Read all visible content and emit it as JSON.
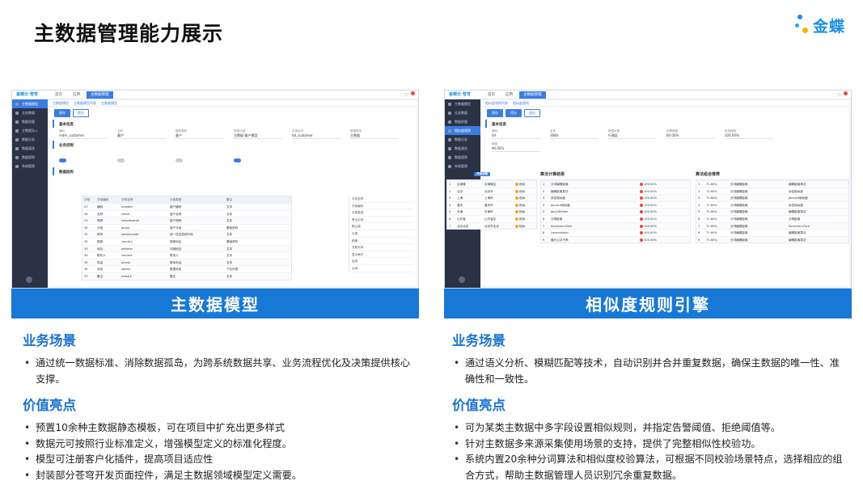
{
  "page": {
    "title": "主数据管理能力展示",
    "logo_text": "金蝶"
  },
  "left": {
    "caption": "主数据模型",
    "app": {
      "brand": "金蝶云·苍穹",
      "tabs": [
        "首页",
        "应用",
        "主数据管理"
      ],
      "sidebar": [
        "主数据模型",
        "业务数据",
        "数据质量",
        "主数据导入",
        "数据分发",
        "数据清洗",
        "数据规则",
        "系统管理"
      ],
      "breadcrumb": [
        "主数据模型",
        "主数据模型列表",
        "主数据模型"
      ],
      "buttons": [
        "保存",
        "提交"
      ],
      "section_basic": "基本信息",
      "fields": [
        {
          "label": "编码",
          "value": "mdm_customer"
        },
        {
          "label": "名称",
          "value": "客户"
        },
        {
          "label": "模型类型",
          "value": "客户"
        },
        {
          "label": "所属分组",
          "value": "主数据-客户模型"
        },
        {
          "label": "实体标识",
          "value": "bd_customer"
        },
        {
          "label": "数据版本",
          "value": "主数据"
        }
      ],
      "section_business": "业务控制",
      "section_fields": "数据结构",
      "grid_headers": [
        "字段",
        "字段编码",
        "字段名称",
        "字段类型",
        "备注"
      ],
      "grid_rows": [
        [
          "27",
          "编码",
          "number",
          "客户编码",
          "文本"
        ],
        [
          "28",
          "名称",
          "name",
          "客户名称",
          "文本"
        ],
        [
          "29",
          "简称",
          "simplename",
          "客户简称",
          "文本"
        ],
        [
          "30",
          "分组",
          "group",
          "客户分组",
          "基础资料"
        ],
        [
          "31",
          "税号",
          "societycode",
          "统一社会信用代码",
          "文本"
        ],
        [
          "32",
          "国家",
          "country",
          "国家地区",
          "基础资料"
        ],
        [
          "33",
          "地址",
          "address",
          "详细地址",
          "文本"
        ],
        [
          "34",
          "联系人",
          "contact",
          "联系人",
          "文本"
        ],
        [
          "35",
          "电话",
          "phone",
          "联系电话",
          "文本"
        ],
        [
          "36",
          "状态",
          "status",
          "数据状态",
          "下拉列表"
        ],
        [
          "37",
          "备注",
          "remark",
          "备注",
          "文本"
        ]
      ],
      "props": [
        "字段名称",
        "字段编码",
        "字段类型",
        "是否必录",
        "默认值",
        "长度",
        "精度",
        "关联实体",
        "显示格式",
        "启用",
        "必填"
      ]
    },
    "scene_heading": "业务场景",
    "scene": [
      "通过统一数据标准、消除数据孤岛，为跨系统数据共享、业务流程优化及决策提供核心支撑。"
    ],
    "value_heading": "价值亮点",
    "values": [
      "预置10余种主数据静态模板，可在项目中扩充出更多样式",
      "数据元可按照行业标准定义，增强模型定义的标准化程度。",
      "模型可注册客户化插件，提高项目适应性",
      "封装部分苍穹开发页面控件，满足主数据领域模型定义需要。"
    ]
  },
  "right": {
    "caption": "相似度规则引擎",
    "app": {
      "brand": "金蝶云·苍穹",
      "tabs": [
        "首页",
        "应用",
        "主数据管理"
      ],
      "sidebar": [
        "主数据模型",
        "业务数据",
        "数据质量",
        "相似度规则",
        "数据分发",
        "数据清洗",
        "数据规则",
        "系统管理"
      ],
      "breadcrumb": [
        "相似度规则列表",
        "相似度规则"
      ],
      "buttons": [
        "保存",
        "提交",
        "退出"
      ],
      "section_basic": "基本信息",
      "fields": [
        {
          "label": "编码",
          "value": "04"
        },
        {
          "label": "名称",
          "value": "3884"
        },
        {
          "label": "数据对象",
          "value": "行政区"
        },
        {
          "label": "告警阈值",
          "value": "60.00%"
        },
        {
          "label": "拒绝阈值",
          "value": "100.00%"
        },
        {
          "label": "阈值",
          "value": "90.00%"
        }
      ],
      "train_title": "算法训练文本",
      "train_tag": "开始训练",
      "calc_title": "算法计算结果",
      "combo_title": "算法组合推荐",
      "train_rows": [
        [
          "1",
          "京津冀",
          "京津冀区",
          "相似"
        ],
        [
          "2",
          "北京",
          "北京市",
          "相似"
        ],
        [
          "3",
          "上海",
          "上海市",
          "相似"
        ],
        [
          "4",
          "重庆",
          "重庆市",
          "相似"
        ],
        [
          "5",
          "天津",
          "天津市",
          "相似"
        ],
        [
          "6",
          "山东省",
          "山东省区",
          "相似"
        ],
        [
          "7",
          "北京北京",
          "北京市北京",
          "相似"
        ]
      ],
      "calc_rows": [
        [
          "1",
          "分词编辑距离",
          "100.00%"
        ],
        [
          "2",
          "编辑距离算法",
          "100.00%"
        ],
        [
          "3",
          "余弦相似度",
          "100.00%"
        ],
        [
          "4",
          "Jaccard相似度",
          "100.00%"
        ],
        [
          "5",
          "Jaro-Winkler",
          "100.00%"
        ],
        [
          "6",
          "汉明距离",
          "100.00%"
        ],
        [
          "7",
          "Sorensen-Dice",
          "100.00%"
        ],
        [
          "8",
          "Levenshtein",
          "100.00%"
        ],
        [
          "9",
          "最长公共子串",
          "100.00%"
        ]
      ],
      "combo_rows": [
        [
          "1",
          "71.60%",
          "分词编辑距离",
          "编辑距离算法"
        ],
        [
          "2",
          "71.60%",
          "分词编辑距离",
          "余弦相似度"
        ],
        [
          "3",
          "71.60%",
          "分词编辑距离",
          "Jaccard相似度"
        ],
        [
          "4",
          "71.60%",
          "分词编辑距离",
          "余弦相似度"
        ],
        [
          "5",
          "71.60%",
          "分词编辑距离",
          "编辑距离算法"
        ],
        [
          "6",
          "71.60%",
          "分词编辑距离",
          "汉明距离"
        ],
        [
          "7",
          "71.60%",
          "分词编辑距离",
          "Sorensen-Dice"
        ],
        [
          "8",
          "71.60%",
          "分词编辑距离",
          "编辑距离算法"
        ],
        [
          "9",
          "71.60%",
          "分词编辑距离",
          "编辑距离算法"
        ]
      ]
    },
    "scene_heading": "业务场景",
    "scene": [
      "通过语义分析、模糊匹配等技术，自动识别并合并重复数据，确保主数据的唯一性、准确性和一致性。"
    ],
    "value_heading": "价值亮点",
    "values": [
      "可为某类主数据中多字段设置相似规则，并指定告警阈值、拒绝阈值等。",
      "针对主数据多来源采集使用场景的支持，提供了完整相似性校验功。",
      "系统内置20余种分词算法和相似度校验算法，可根据不同校验场景特点，选择相应的组合方式，帮助主数据管理人员识别冗余重复数据。"
    ]
  },
  "colors": {
    "accent": "#1878d6",
    "heading": "#1a73d1",
    "brand": "#1a8fe3"
  }
}
